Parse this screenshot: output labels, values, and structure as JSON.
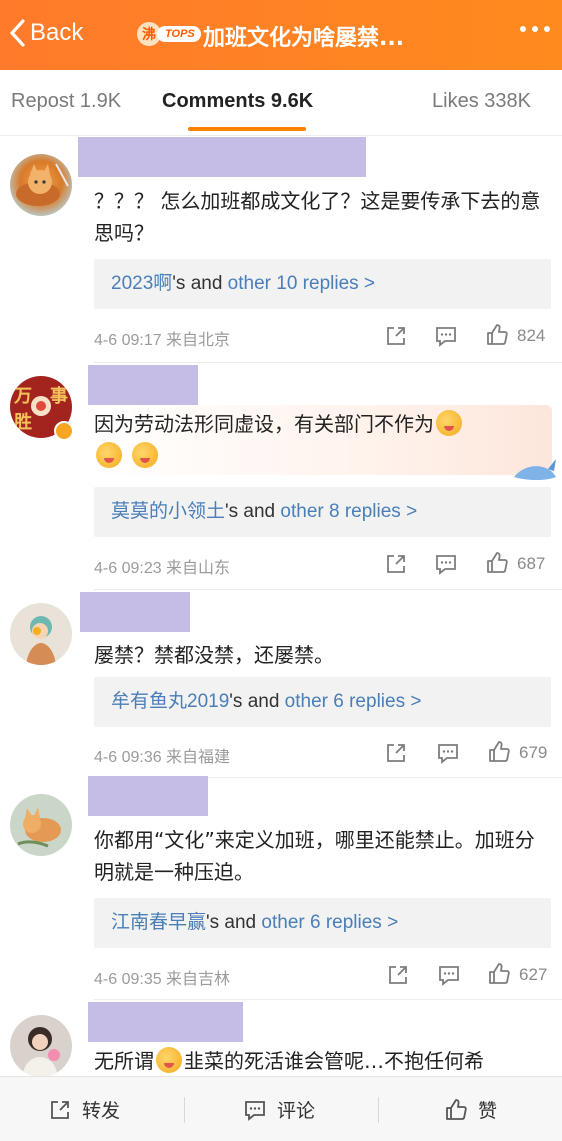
{
  "header": {
    "back_label": "Back",
    "hot_char": "沸",
    "hot_tag": "TOPS",
    "title": "加班文化为啥屡禁..."
  },
  "tabs": {
    "repost": "Repost 1.9K",
    "comments": "Comments 9.6K",
    "likes": "Likes 338K"
  },
  "comments": [
    {
      "text": "？？？ 怎么加班都成文化了？这是要传承下去的意思吗？",
      "reply_user": "2023啊",
      "reply_mid": "'s and ",
      "reply_other": "other 10 replies >",
      "meta": "4-6 09:17  来自北京",
      "likes": "824"
    },
    {
      "text": "因为劳动法形同虚设，有关部门不作为",
      "reply_user": "莫莫的小领土",
      "reply_mid": "'s and ",
      "reply_other": "other 8 replies >",
      "meta": "4-6 09:23  来自山东",
      "likes": "687"
    },
    {
      "text": "屡禁？禁都没禁，还屡禁。",
      "reply_user": "牟有鱼丸2019",
      "reply_mid": "'s and ",
      "reply_other": "other 6 replies >",
      "meta": "4-6 09:36  来自福建",
      "likes": "679"
    },
    {
      "text": "你都用“文化”来定义加班，哪里还能禁止。加班分明就是一种压迫。",
      "reply_user": "江南春早赢",
      "reply_mid": "'s and ",
      "reply_other": "other 6 replies >",
      "meta": "4-6 09:35  来自吉林",
      "likes": "627"
    },
    {
      "text_before": "无所谓",
      "text_after": "韭菜的死活谁会管呢…不抱任何希"
    }
  ],
  "bottom_bar": {
    "repost": "转发",
    "comment": "评论",
    "like": "赞"
  },
  "colors": {
    "header_orange": "#ff7a2a",
    "tab_underline": "#ff8200",
    "link_blue": "#4a7eb8",
    "name_placeholder": "#c6bde6"
  }
}
